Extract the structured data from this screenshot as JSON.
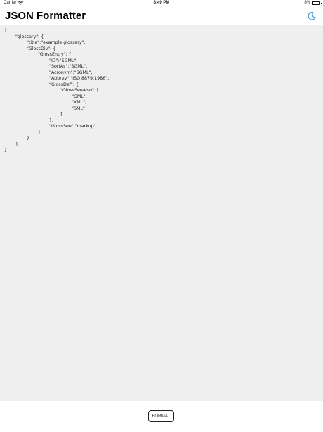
{
  "status_bar": {
    "carrier": "Carrier",
    "wifi_icon": "wifi-icon",
    "time": "8:49 PM",
    "battery_percent": "8%",
    "battery_level": 0.08
  },
  "nav": {
    "title": "JSON Formatter",
    "theme_icon": "moon-icon",
    "accent_color": "#2f8fd6"
  },
  "editor": {
    "lines": [
      "{",
      "        \"glossary\": {",
      "                \"title\":\"example glossary\",",
      "                \"GlossDiv\": {",
      "                        \"GlossEntry\": {",
      "                                \"ID\":\"SGML\",",
      "                                \"SortAs\":\"SGML\",",
      "                                \"Acronym\":\"SGML\",",
      "                                \"Abbrev\":\"ISO 8879:1986\",",
      "                                \"GlossDef\": {",
      "                                        \"GlossSeeAlso\": [",
      "                                                \"GML\",",
      "                                                \"XML\",",
      "                                                \"SML\"",
      "                                        ]",
      "                                },",
      "                                \"GlossSee\":\"markup\"",
      "                        }",
      "                }",
      "        }",
      "}"
    ]
  },
  "bottom": {
    "format_label": "FORMAT"
  }
}
